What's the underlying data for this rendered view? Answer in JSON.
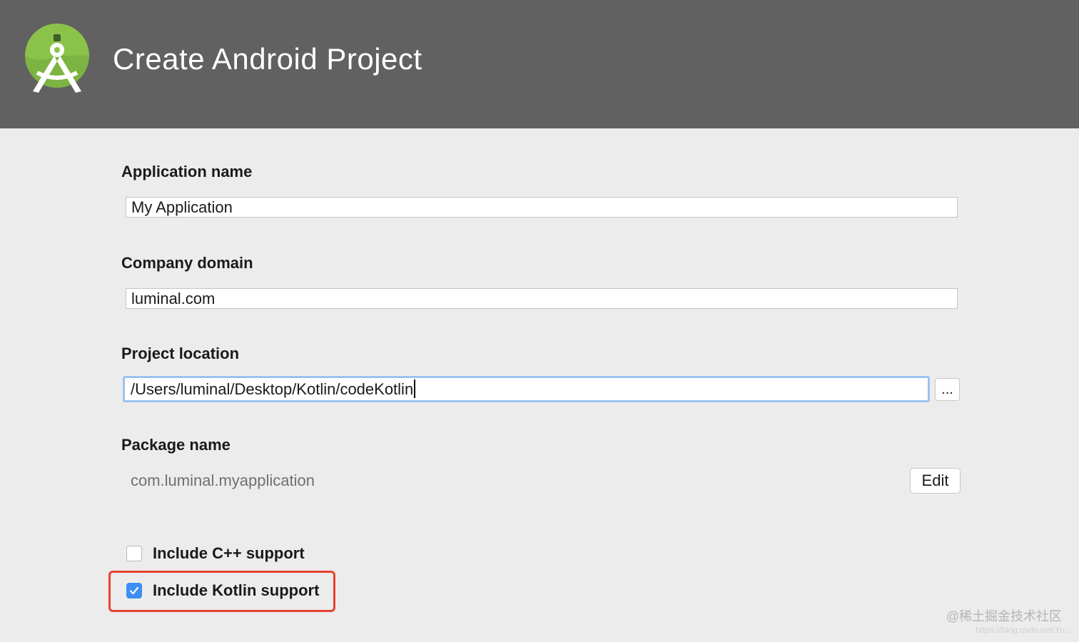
{
  "header": {
    "title": "Create Android Project"
  },
  "form": {
    "application_name": {
      "label": "Application name",
      "value": "My Application"
    },
    "company_domain": {
      "label": "Company domain",
      "value": "luminal.com"
    },
    "project_location": {
      "label": "Project location",
      "value": "/Users/luminal/Desktop/Kotlin/codeKotlin",
      "browse_label": "..."
    },
    "package_name": {
      "label": "Package name",
      "value": "com.luminal.myapplication",
      "edit_label": "Edit"
    }
  },
  "options": {
    "cpp": {
      "label": "Include C++ support",
      "checked": false
    },
    "kotlin": {
      "label": "Include Kotlin support",
      "checked": true
    }
  },
  "watermark": {
    "text": "@稀土掘金技术社区",
    "url": "https://blog.csdn.net/Yu..."
  },
  "colors": {
    "header_bg": "#616161",
    "body_bg": "#ececec",
    "focus_ring": "#9cc3ee",
    "checkbox_checked": "#3d8ef5",
    "highlight": "#e5432f",
    "android_green": "#8bc34a"
  }
}
